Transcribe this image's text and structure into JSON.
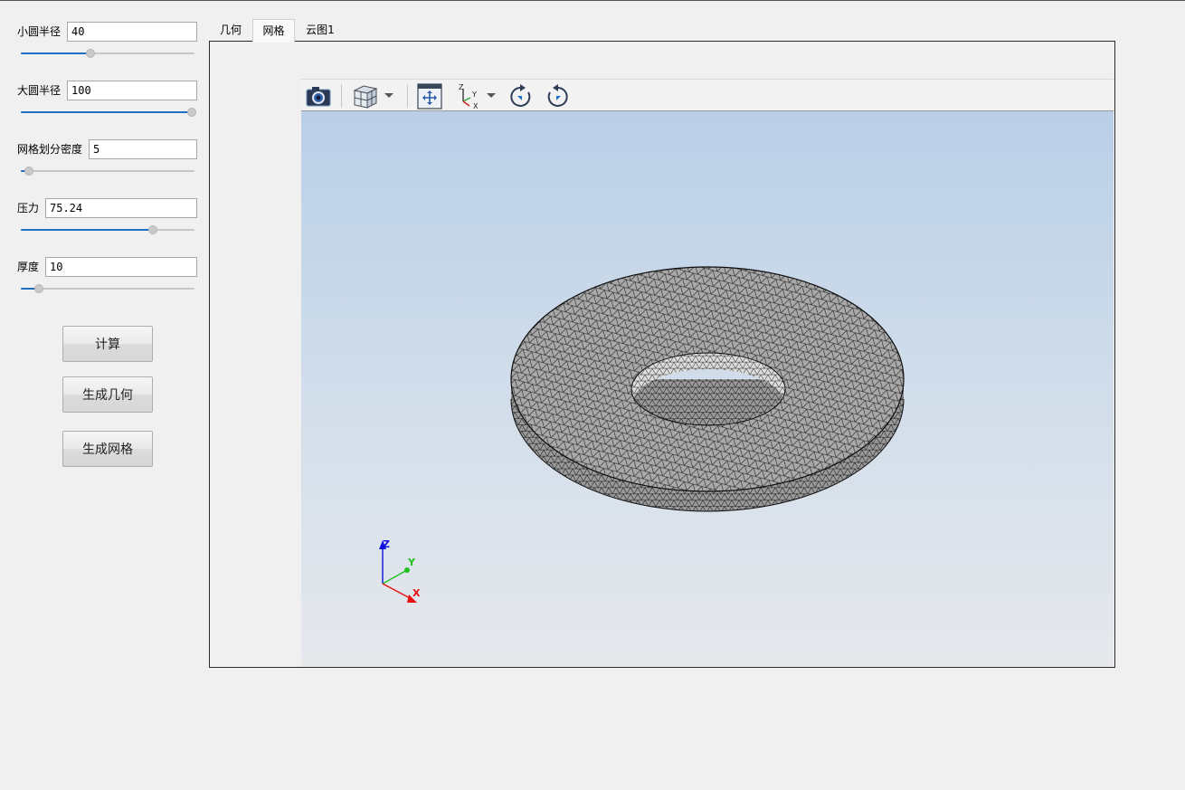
{
  "params": [
    {
      "label": "小圆半径",
      "value": "40",
      "slider_fraction": 0.4
    },
    {
      "label": "大圆半径",
      "value": "100",
      "slider_fraction": 1.0
    },
    {
      "label": "网格划分密度",
      "value": "5",
      "slider_fraction": 0.03
    },
    {
      "label": "压力",
      "value": "75.24",
      "slider_fraction": 0.77
    },
    {
      "label": "厚度",
      "value": "10",
      "slider_fraction": 0.09
    }
  ],
  "buttons": {
    "compute": "计算",
    "generate_geometry": "生成几何",
    "generate_mesh": "生成网格"
  },
  "tabs": [
    {
      "label": "几何",
      "active": false
    },
    {
      "label": "网格",
      "active": true
    },
    {
      "label": "云图1",
      "active": false
    }
  ],
  "toolbar": {
    "icons": [
      "camera-icon",
      "view-cube-icon",
      "dropdown-arrow-icon",
      "fit-view-icon",
      "axes-icon",
      "dropdown-arrow-icon",
      "rotate-cw-icon",
      "rotate-ccw-icon"
    ],
    "axes_icon_labels": {
      "z": "Z",
      "y": "Y",
      "x": "X"
    }
  },
  "orientation_triad": {
    "x": "X",
    "y": "Y",
    "z": "Z"
  },
  "colors": {
    "accent": "#1f6fc5",
    "x_axis": "#e81010",
    "y_axis": "#20c020",
    "z_axis": "#1010e0",
    "mesh_face": "#a8a8a8",
    "mesh_edges": "#111111"
  }
}
